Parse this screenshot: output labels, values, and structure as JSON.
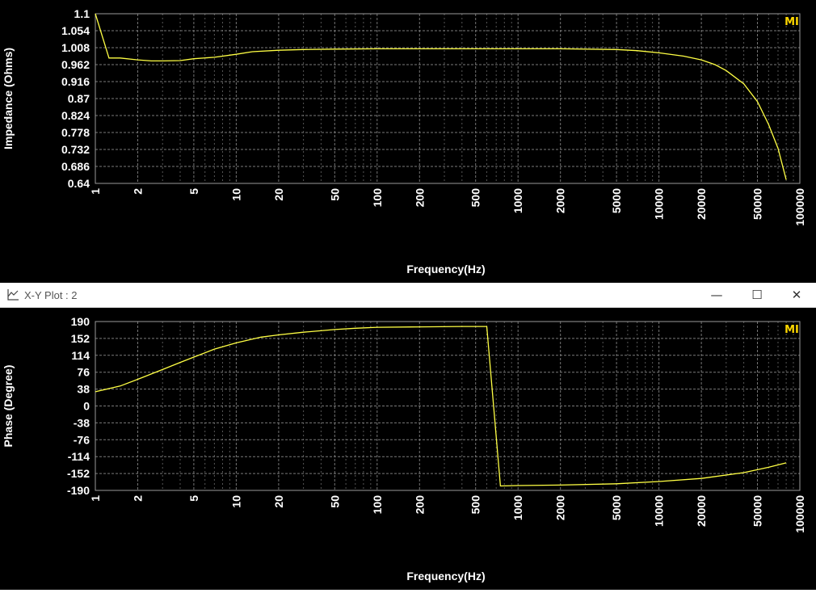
{
  "window": {
    "title": "X-Y Plot : 2",
    "minimize_glyph": "—",
    "maximize_glyph": "☐",
    "close_glyph": "✕"
  },
  "colors": {
    "background": "#000000",
    "trace": "#ffff44",
    "grid": "#7a7a7a",
    "badge": "#ffd800"
  },
  "chart_data": [
    {
      "type": "line",
      "xscale": "log",
      "xlabel": "Frequency(Hz)",
      "ylabel": "Impedance (Ohms)",
      "xlim": [
        1,
        100000
      ],
      "ylim": [
        0.64,
        1.1
      ],
      "yticks": [
        1.1,
        1.054,
        1.008,
        0.962,
        0.916,
        0.87,
        0.824,
        0.778,
        0.732,
        0.686,
        0.64
      ],
      "ytick_labels": [
        "1.1",
        "1.054",
        "1.008",
        "0.962",
        "0.916",
        "0.87",
        "0.824",
        "0.778",
        "0.732",
        "0.686",
        "0.64"
      ],
      "xticks": [
        1,
        2,
        5,
        10,
        20,
        50,
        100,
        200,
        500,
        1000,
        2000,
        5000,
        10000,
        20000,
        50000,
        100000
      ],
      "xtick_labels": [
        "1",
        "2",
        "5",
        "10",
        "20",
        "50",
        "100",
        "200",
        "500",
        "1000",
        "2000",
        "5000",
        "10000",
        "20000",
        "50000",
        "100000"
      ],
      "grid": true,
      "badge": "MI",
      "series": [
        {
          "x": [
            1,
            1.25,
            1.5,
            2,
            2.5,
            3,
            4,
            5,
            7,
            10,
            13,
            20,
            30,
            50,
            100,
            200,
            500,
            1000,
            2000,
            5000,
            7000,
            10000,
            15000,
            20000,
            25000,
            30000,
            40000,
            50000,
            60000,
            70000,
            80000
          ],
          "y": [
            1.1,
            0.98,
            0.98,
            0.975,
            0.972,
            0.972,
            0.973,
            0.978,
            0.982,
            0.99,
            0.997,
            1.001,
            1.003,
            1.004,
            1.005,
            1.005,
            1.005,
            1.005,
            1.005,
            1.003,
            1.0,
            0.994,
            0.985,
            0.975,
            0.962,
            0.946,
            0.91,
            0.862,
            0.8,
            0.735,
            0.65
          ]
        }
      ]
    },
    {
      "type": "line",
      "xscale": "log",
      "xlabel": "Frequency(Hz)",
      "ylabel": "Phase (Degree)",
      "xlim": [
        1,
        100000
      ],
      "ylim": [
        -190,
        190
      ],
      "yticks": [
        190,
        152,
        114,
        76,
        38,
        0,
        -38,
        -76,
        -114,
        -152,
        -190
      ],
      "ytick_labels": [
        "190",
        "152",
        "114",
        "76",
        "38",
        "0",
        "-38",
        "-76",
        "-114",
        "-152",
        "-190"
      ],
      "xticks": [
        1,
        2,
        5,
        10,
        20,
        50,
        100,
        200,
        500,
        1000,
        2000,
        5000,
        10000,
        20000,
        50000,
        100000
      ],
      "xtick_labels": [
        "1",
        "2",
        "5",
        "10",
        "20",
        "50",
        "100",
        "200",
        "500",
        "1000",
        "2000",
        "5000",
        "10000",
        "20000",
        "50000",
        "100000"
      ],
      "grid": true,
      "badge": "MI",
      "series": [
        {
          "x": [
            1,
            1.5,
            2,
            3,
            4,
            5,
            7,
            10,
            15,
            20,
            30,
            50,
            70,
            100,
            200,
            400,
            600,
            750,
            1000,
            2000,
            5000,
            10000,
            20000,
            40000,
            60000,
            80000
          ],
          "y": [
            32,
            45,
            60,
            82,
            98,
            110,
            128,
            142,
            155,
            160,
            166,
            172,
            175,
            177,
            178,
            179,
            179,
            -180,
            -179,
            -178,
            -175,
            -170,
            -163,
            -150,
            -138,
            -128
          ]
        }
      ]
    }
  ]
}
